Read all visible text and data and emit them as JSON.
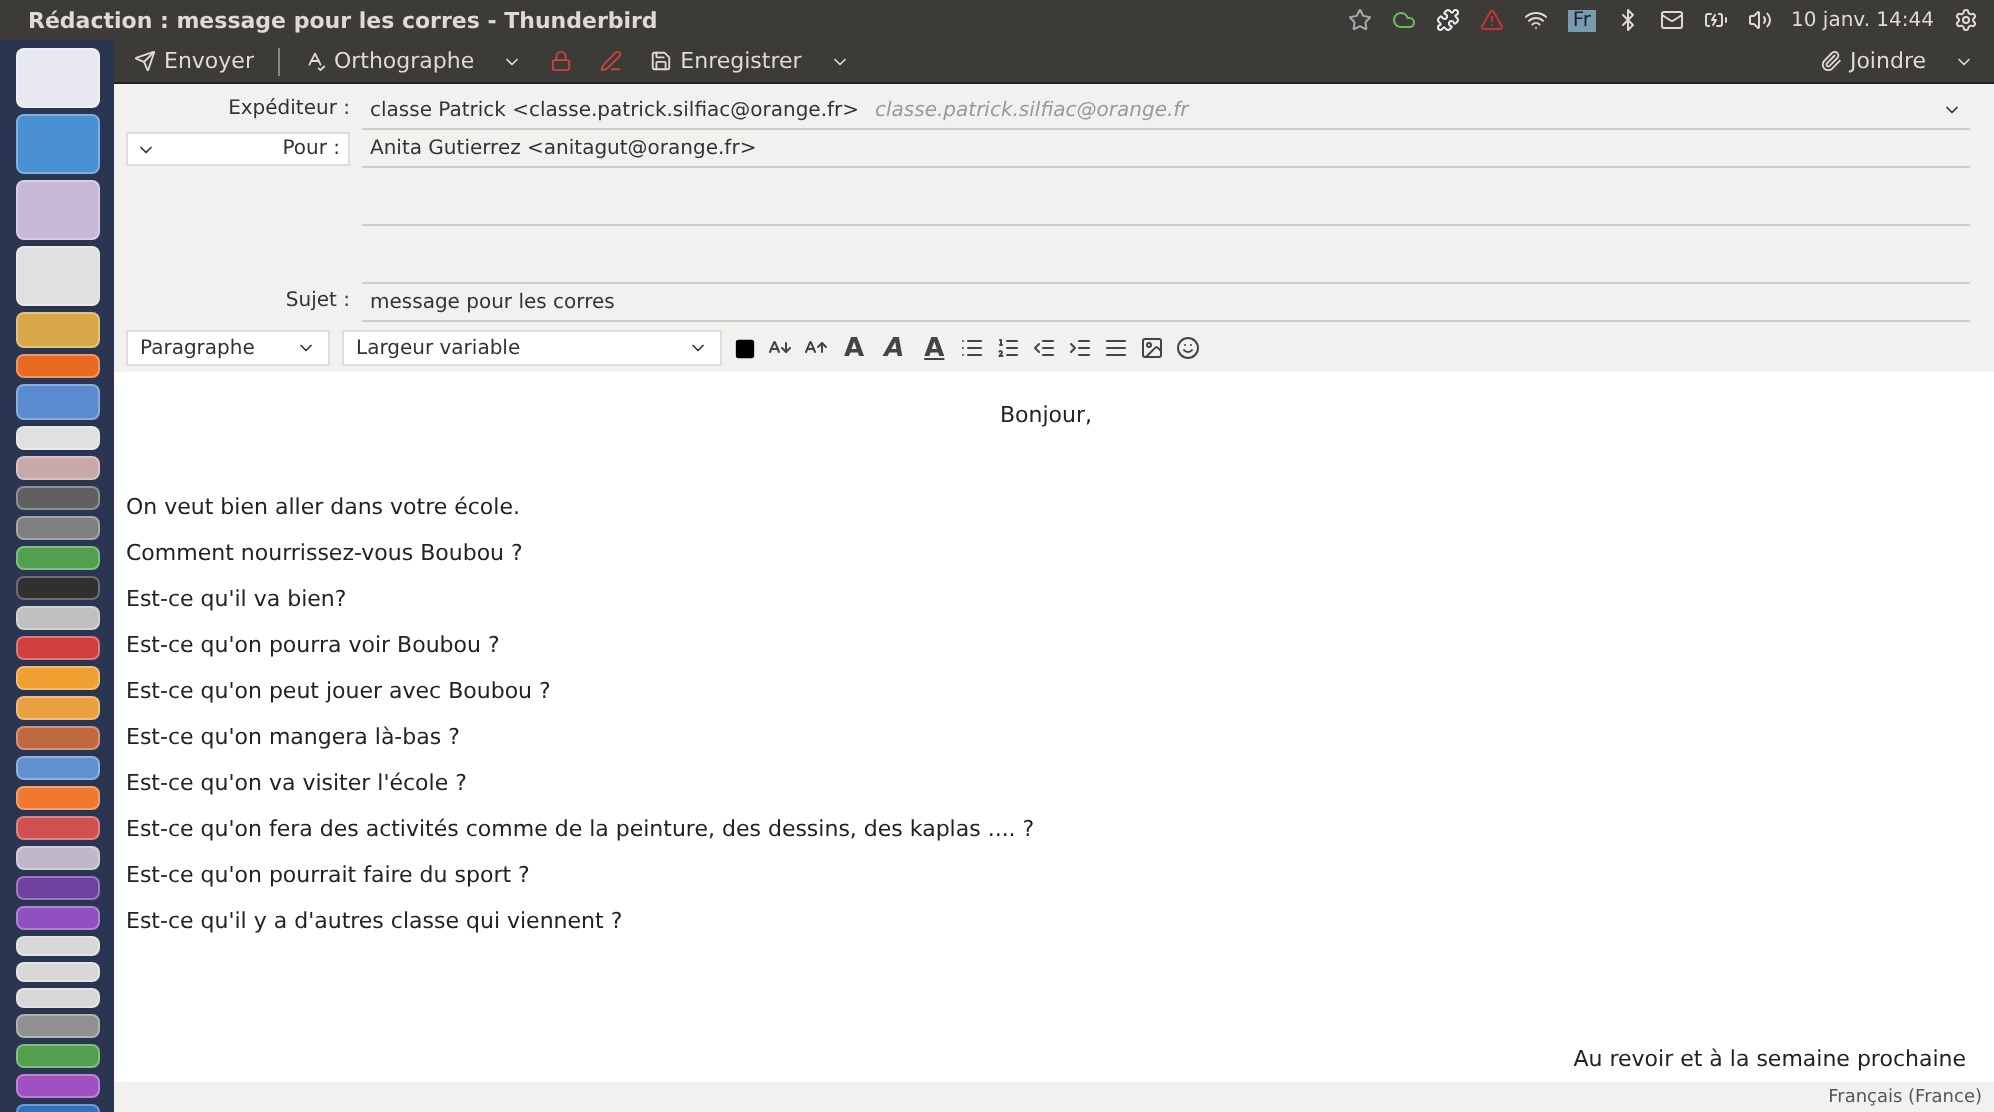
{
  "window": {
    "title": "Rédaction : message pour les corres - Thunderbird"
  },
  "panel": {
    "keyboard": "Fr",
    "clock": "10 janv. 14:44"
  },
  "toolbar": {
    "buttons": [
      {
        "kind": "send",
        "label": "Envoyer"
      },
      {
        "kind": "spell",
        "label": "Orthographe"
      },
      {
        "kind": "security"
      },
      {
        "kind": "sign"
      },
      {
        "kind": "save",
        "label": "Enregistrer"
      }
    ],
    "attach": "Joindre"
  },
  "header": {
    "from_label": "Expéditeur :",
    "from_value": "classe Patrick <classe.patrick.silfiac@orange.fr>",
    "from_hint": "classe.patrick.silfiac@orange.fr",
    "to_label": "Pour :",
    "to_value": "Anita Gutierrez <anitagut@orange.fr>",
    "subject_label": "Sujet :",
    "subject_value": "message pour les corres"
  },
  "format": {
    "paragraph": "Paragraphe",
    "font": "Largeur variable",
    "bold": "A",
    "italic": "A",
    "underline": "A"
  },
  "body": [
    {
      "kind": "greeting",
      "text": "Bonjour,"
    },
    {
      "kind": "line",
      "text": "On veut bien aller dans votre école."
    },
    {
      "kind": "line",
      "text": "Comment nourrissez-vous Boubou ?"
    },
    {
      "kind": "line",
      "text": "Est-ce qu'il va bien?"
    },
    {
      "kind": "line",
      "text": "Est-ce qu'on pourra voir Boubou ?"
    },
    {
      "kind": "line",
      "text": "Est-ce qu'on peut jouer avec Boubou ?"
    },
    {
      "kind": "line",
      "text": "Est-ce qu'on mangera là-bas ?"
    },
    {
      "kind": "line",
      "text": "Est-ce qu'on va visiter l'école ?"
    },
    {
      "kind": "line",
      "text": "Est-ce qu'on fera des activités comme de la peinture, des dessins, des kaplas .... ?"
    },
    {
      "kind": "line",
      "text": "Est-ce qu'on pourrait faire du sport ?"
    },
    {
      "kind": "line",
      "text": "Est-ce qu'il y a d'autres classe qui viennent ?"
    },
    {
      "kind": "closing",
      "text": "Au revoir et à la semaine prochaine"
    }
  ],
  "status_bar": {
    "language": "Français (France)"
  }
}
